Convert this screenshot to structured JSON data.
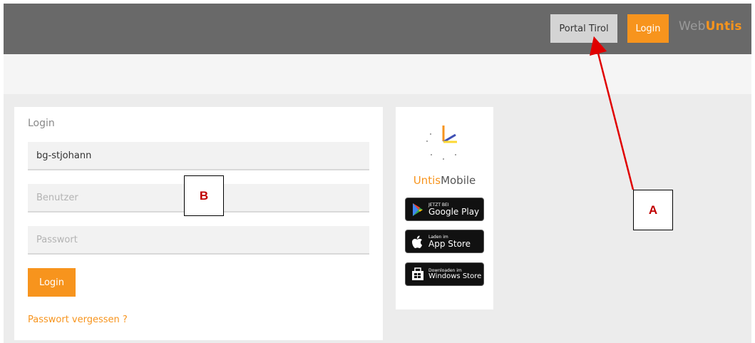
{
  "header": {
    "portal_label": "Portal Tirol",
    "login_label": "Login",
    "logo_web": "Web",
    "logo_untis": "Untis"
  },
  "login_form": {
    "title": "Login",
    "school_value": "bg-stjohann",
    "user_placeholder": "Benutzer",
    "password_placeholder": "Passwort",
    "submit_label": "Login",
    "forgot_label": "Passwort vergessen ?"
  },
  "mobile": {
    "name_prefix": "Untis",
    "name_suffix": "Mobile",
    "badges": [
      {
        "small": "JETZT BEI",
        "big": "Google Play"
      },
      {
        "small": "Laden im",
        "big": "App Store"
      },
      {
        "small": "Downloaden im",
        "big": "Windows Store"
      }
    ]
  },
  "annotations": {
    "a": "A",
    "b": "B"
  },
  "colors": {
    "accent": "#f7941d",
    "topbar": "#696969",
    "annotation": "#c00000"
  }
}
